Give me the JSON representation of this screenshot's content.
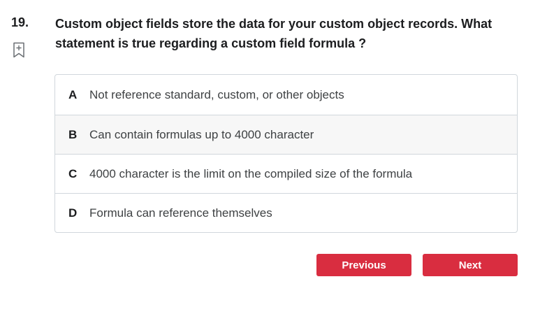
{
  "question": {
    "number": "19.",
    "text": "Custom object fields store the data for your custom object records. What statement is true regarding a custom field formula ?"
  },
  "bookmark": {
    "icon": "bookmark-plus-icon"
  },
  "options": [
    {
      "letter": "A",
      "text": "Not reference standard, custom, or other objects"
    },
    {
      "letter": "B",
      "text": "Can contain formulas up to 4000 character"
    },
    {
      "letter": "C",
      "text": "4000 character is the limit on the compiled size of the formula"
    },
    {
      "letter": "D",
      "text": "Formula can reference themselves"
    }
  ],
  "navigation": {
    "previous_label": "Previous",
    "next_label": "Next"
  },
  "colors": {
    "accent": "#d92d40",
    "highlight_row": "#f7f7f7",
    "border": "#d1d7dc"
  }
}
